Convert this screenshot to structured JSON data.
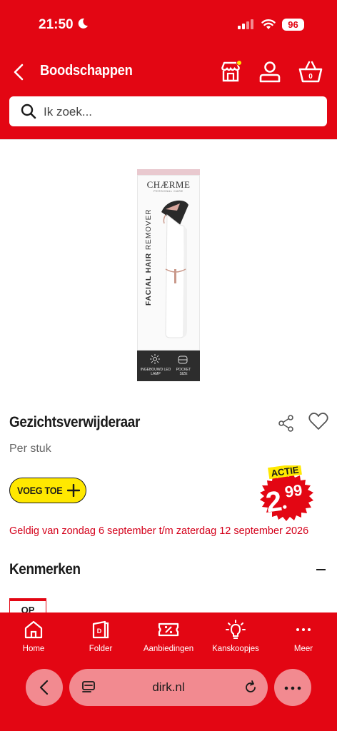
{
  "status": {
    "time": "21:50",
    "battery": "96"
  },
  "header": {
    "title": "Boodschappen",
    "basket_count": "0"
  },
  "search": {
    "placeholder": "Ik zoek..."
  },
  "product": {
    "brand": "CHÆRME",
    "brand_sub": "PERSONAL CARE",
    "box_text_bold": "FACIAL HAIR",
    "box_text": " REMOVER",
    "feature_1": "INGEBOUWD LED LAMP",
    "feature_2": "POCKET SIZE",
    "title": "Gezichtsverwijderaar",
    "unit": "Per stuk",
    "add_label": "VOEG TOE",
    "price_badge": "ACTIE",
    "price_main": "2",
    "price_cents": "99",
    "validity": "Geldig van zondag 6 september t/m zaterdag 12 september 2026"
  },
  "section": {
    "title": "Kenmerken",
    "partial_logo": "OP"
  },
  "nav": {
    "items": [
      {
        "label": "Home"
      },
      {
        "label": "Folder"
      },
      {
        "label": "Aanbiedingen"
      },
      {
        "label": "Kanskoopjes"
      },
      {
        "label": "Meer"
      }
    ]
  },
  "browser": {
    "url": "dirk.nl"
  },
  "colors": {
    "brand_red": "#e30613",
    "yellow": "#ffe800",
    "validity_red": "#d4001a"
  }
}
